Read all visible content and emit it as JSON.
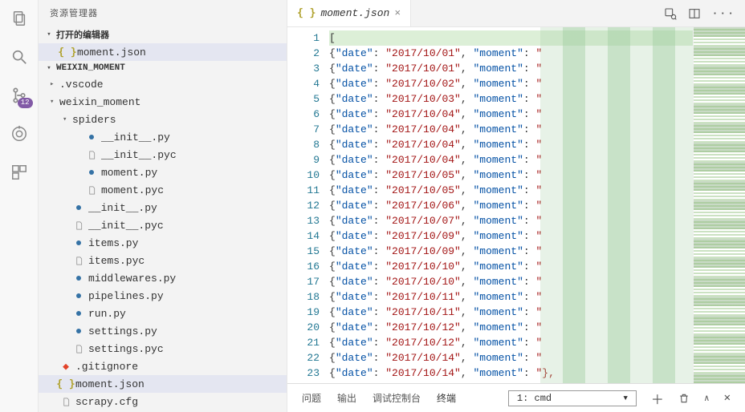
{
  "sidebar_title": "资源管理器",
  "open_editors": {
    "label": "打开的编辑器",
    "items": [
      {
        "name": "moment.json",
        "icon": "json"
      }
    ]
  },
  "project": {
    "name": "WEIXIN_MOMENT",
    "tree": [
      {
        "label": ".vscode",
        "type": "folder",
        "expanded": false,
        "indent": 0
      },
      {
        "label": "weixin_moment",
        "type": "folder",
        "expanded": true,
        "indent": 0
      },
      {
        "label": "spiders",
        "type": "folder",
        "expanded": true,
        "indent": 1
      },
      {
        "label": "__init__.py",
        "type": "file",
        "icon": "py",
        "indent": 2
      },
      {
        "label": "__init__.pyc",
        "type": "file",
        "icon": "file",
        "indent": 2
      },
      {
        "label": "moment.py",
        "type": "file",
        "icon": "py",
        "indent": 2
      },
      {
        "label": "moment.pyc",
        "type": "file",
        "icon": "file",
        "indent": 2
      },
      {
        "label": "__init__.py",
        "type": "file",
        "icon": "py",
        "indent": 1
      },
      {
        "label": "__init__.pyc",
        "type": "file",
        "icon": "file",
        "indent": 1
      },
      {
        "label": "items.py",
        "type": "file",
        "icon": "py",
        "indent": 1
      },
      {
        "label": "items.pyc",
        "type": "file",
        "icon": "file",
        "indent": 1
      },
      {
        "label": "middlewares.py",
        "type": "file",
        "icon": "py",
        "indent": 1
      },
      {
        "label": "pipelines.py",
        "type": "file",
        "icon": "py",
        "indent": 1
      },
      {
        "label": "run.py",
        "type": "file",
        "icon": "py",
        "indent": 1
      },
      {
        "label": "settings.py",
        "type": "file",
        "icon": "py",
        "indent": 1
      },
      {
        "label": "settings.pyc",
        "type": "file",
        "icon": "file",
        "indent": 1
      },
      {
        "label": ".gitignore",
        "type": "file",
        "icon": "git",
        "indent": 0
      },
      {
        "label": "moment.json",
        "type": "file",
        "icon": "json",
        "indent": 0,
        "selected": true
      },
      {
        "label": "scrapy.cfg",
        "type": "file",
        "icon": "file",
        "indent": 0
      }
    ]
  },
  "scm_badge": "12",
  "tab": {
    "title": "moment.json"
  },
  "code": {
    "first_line": "[",
    "key_date": "date",
    "key_moment": "moment",
    "dates": [
      "2017/10/01",
      "2017/10/01",
      "2017/10/02",
      "2017/10/03",
      "2017/10/04",
      "2017/10/04",
      "2017/10/04",
      "2017/10/04",
      "2017/10/05",
      "2017/10/05",
      "2017/10/06",
      "2017/10/07",
      "2017/10/09",
      "2017/10/09",
      "2017/10/10",
      "2017/10/10",
      "2017/10/11",
      "2017/10/11",
      "2017/10/12",
      "2017/10/12",
      "2017/10/14",
      "2017/10/14"
    ],
    "trail_last": "},"
  },
  "panel": {
    "tabs": [
      "问题",
      "输出",
      "调试控制台",
      "终端"
    ],
    "active": 3,
    "terminal_select": "1: cmd"
  }
}
